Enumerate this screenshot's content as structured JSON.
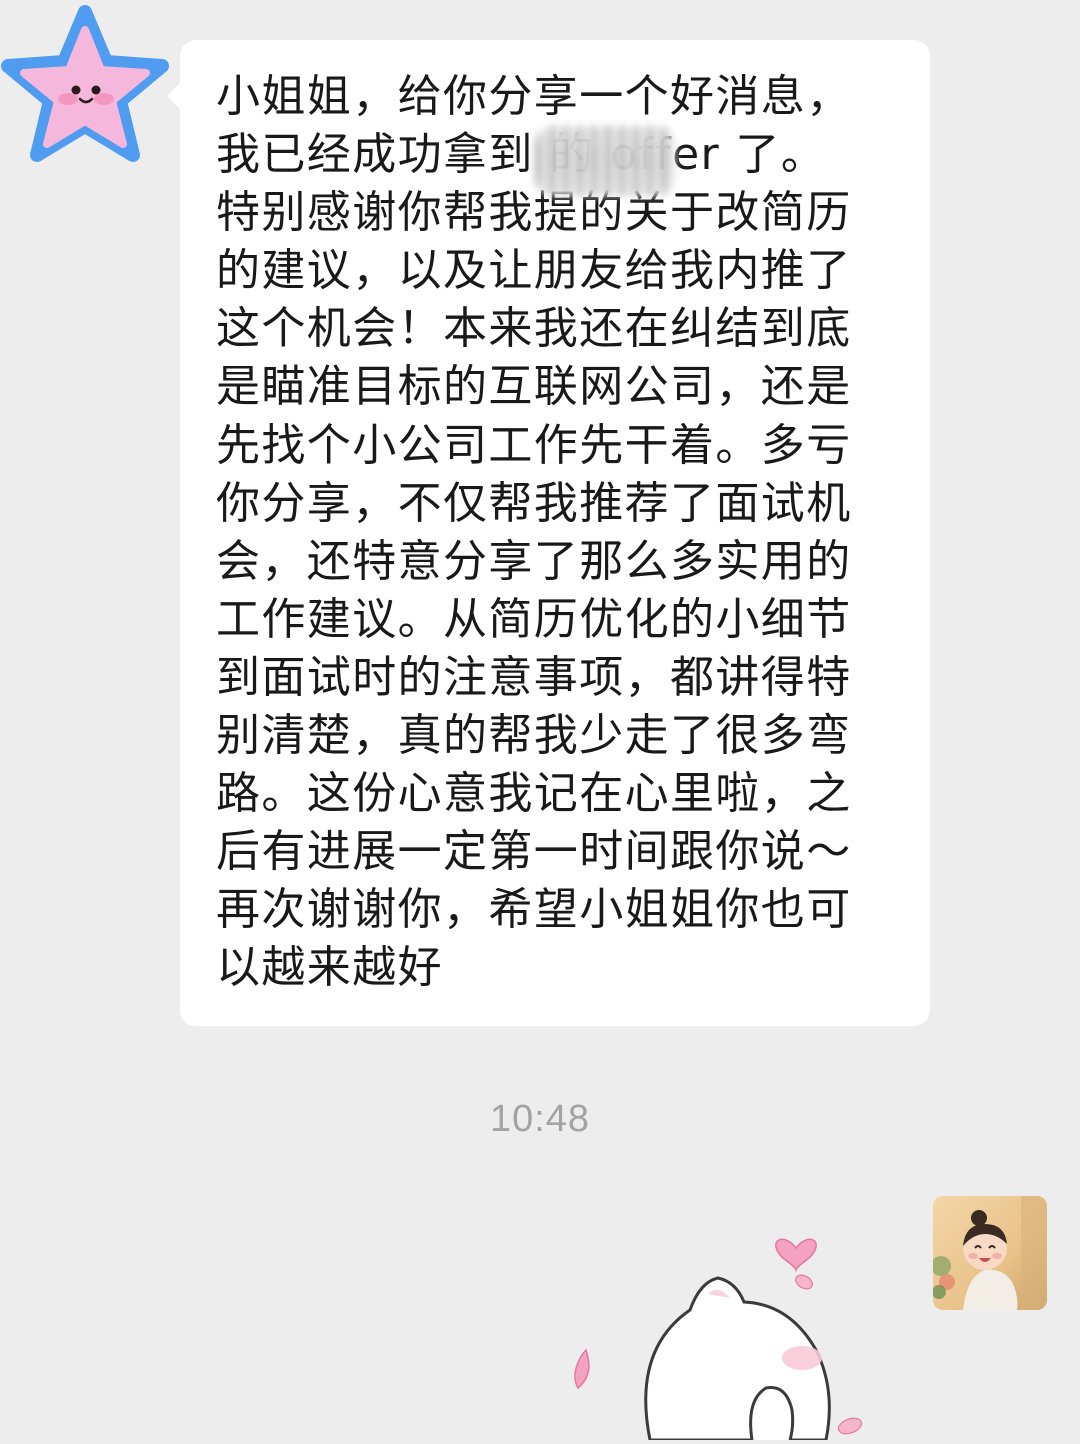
{
  "chat": {
    "incoming": {
      "sender_avatar": "pink-star-avatar",
      "text": "小姐姐，给你分享一个好消息，\n我已经成功拿到         的 offer 了。\n特别感谢你帮我提的关于改简历\n的建议，以及让朋友给我内推了\n这个机会！本来我还在纠结到底\n是瞄准目标的互联网公司，还是\n先找个小公司工作先干着。多亏\n你分享，不仅帮我推荐了面试机\n会，还特意分享了那么多实用的\n工作建议。从简历优化的小细节\n到面试时的注意事项，都讲得特\n别清楚，真的帮我少走了很多弯\n路。这份心意我记在心里啦，之\n后有进展一定第一时间跟你说～\n再次谢谢你，希望小姐姐你也可\n以越来越好"
    },
    "timestamp": "10:48",
    "outgoing": {
      "sender_avatar": "laughing-child-avatar",
      "sticker": "white-cat-hearts-sticker"
    }
  },
  "colors": {
    "background": "#ededed",
    "bubble": "#ffffff",
    "text": "#191919",
    "timestamp": "#a3a3a3",
    "star_outline": "#4f9cf0",
    "star_fill": "#f6b7dc",
    "heart": "#f4a2bf"
  }
}
